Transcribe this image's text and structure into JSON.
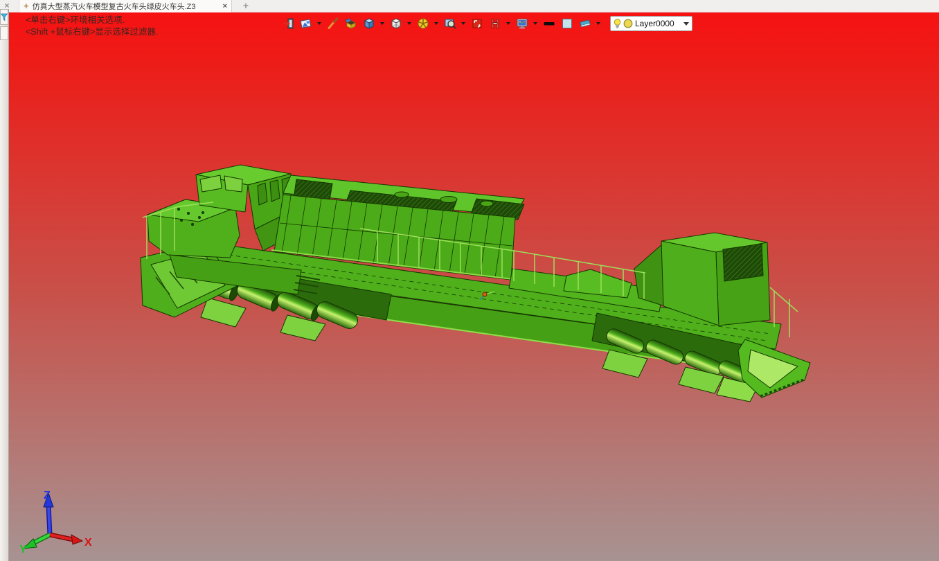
{
  "window": {
    "panel_close_label": "×",
    "tab": {
      "doc_icon": "+",
      "title": "仿真大型蒸汽火车模型复古火车头绿皮火车头.Z3",
      "close_label": "×"
    },
    "new_tab_label": "+"
  },
  "hints": {
    "line1": "<单击右键>环境相关选项.",
    "line2": "<Shift +鼠标右键>显示选择过滤器."
  },
  "toolbar": {
    "items": [
      {
        "name": "exit-icon",
        "dropdown": false
      },
      {
        "name": "display-mode-icon",
        "dropdown": true
      },
      {
        "name": "brush-icon",
        "dropdown": false
      },
      {
        "name": "unfold-box-icon",
        "dropdown": false
      },
      {
        "name": "shaded-cube-icon",
        "dropdown": true
      },
      {
        "name": "wireframe-cube-icon",
        "dropdown": true
      },
      {
        "name": "section-sphere-icon",
        "dropdown": true
      },
      {
        "name": "zoom-region-icon",
        "dropdown": true
      },
      {
        "name": "viewport-window-icon",
        "dropdown": false
      },
      {
        "name": "section-view-icon",
        "dropdown": true
      },
      {
        "name": "monitor-icon",
        "dropdown": true
      },
      {
        "name": "line-width-icon",
        "dropdown": false
      },
      {
        "name": "color-swatch-icon",
        "dropdown": false
      },
      {
        "name": "eraser-icon",
        "dropdown": true
      }
    ]
  },
  "layer_selector": {
    "value": "Layer0000"
  },
  "triad": {
    "x_label": "X",
    "y_label": "Y",
    "z_label": "Z",
    "x_color": "#d81414",
    "y_color": "#1ec128",
    "z_color": "#2337dd"
  },
  "scene": {
    "bg_top_color": "#f61212",
    "bg_bottom_color": "#a79392",
    "model_fill_color": "#4fae1c",
    "model_outline_color": "#143700",
    "model_highlight_color": "#c6f36e"
  }
}
